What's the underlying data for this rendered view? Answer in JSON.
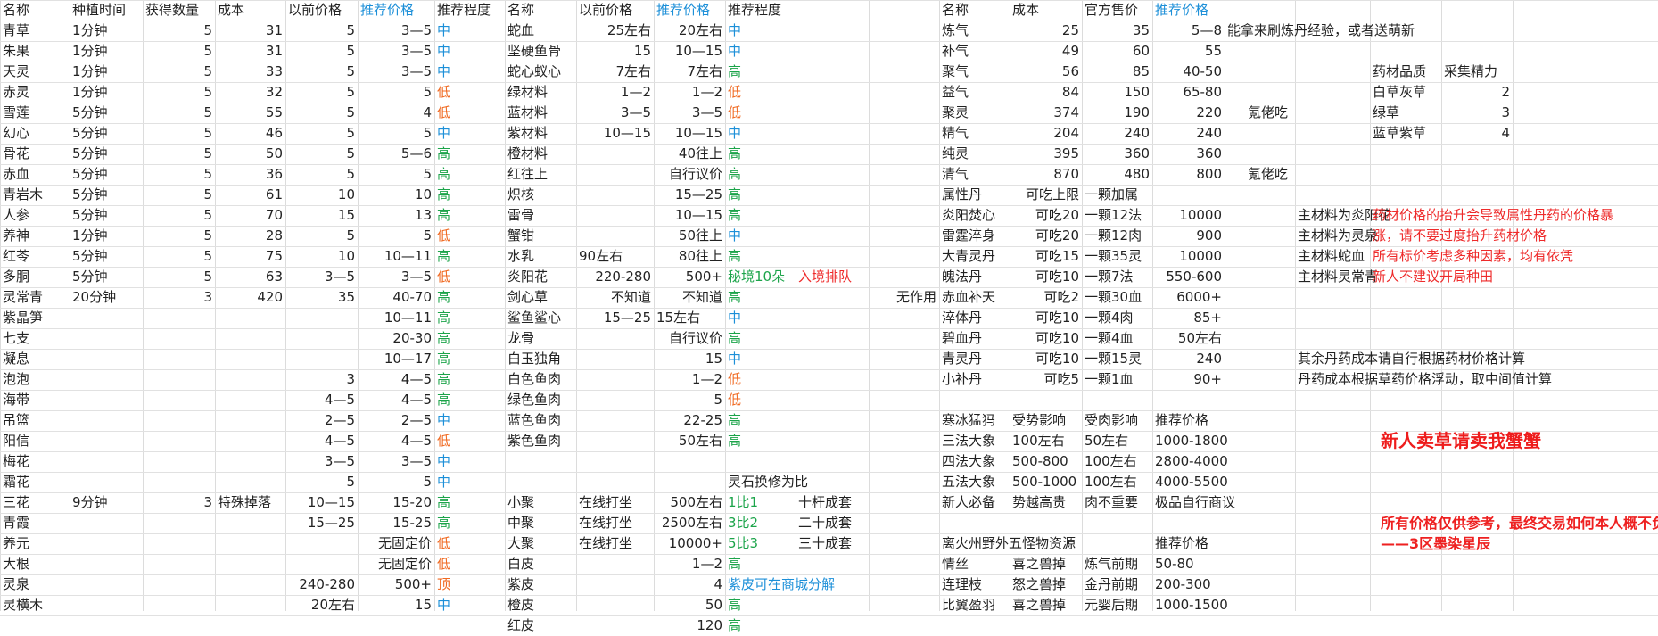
{
  "headers": {
    "a": [
      "名称",
      "种植时间",
      "获得数量",
      "成本",
      "以前价格",
      "推荐价格",
      "推荐程度"
    ],
    "b": [
      "名称",
      "以前价格",
      "推荐价格",
      "推荐程度"
    ],
    "c": [
      "名称",
      "成本",
      "官方售价",
      "推荐价格"
    ]
  },
  "herbs": [
    [
      "青草",
      "1分钟",
      "5",
      "31",
      "5",
      "3—5",
      "中"
    ],
    [
      "朱果",
      "1分钟",
      "5",
      "31",
      "5",
      "3—5",
      "中"
    ],
    [
      "天灵",
      "1分钟",
      "5",
      "33",
      "5",
      "3—5",
      "中"
    ],
    [
      "赤灵",
      "1分钟",
      "5",
      "32",
      "5",
      "5",
      "低"
    ],
    [
      "雪莲",
      "5分钟",
      "5",
      "55",
      "5",
      "4",
      "低"
    ],
    [
      "幻心",
      "5分钟",
      "5",
      "46",
      "5",
      "5",
      "中"
    ],
    [
      "骨花",
      "5分钟",
      "5",
      "50",
      "5",
      "5—6",
      "高"
    ],
    [
      "赤血",
      "5分钟",
      "5",
      "36",
      "5",
      "5",
      "高"
    ],
    [
      "青岩木",
      "5分钟",
      "5",
      "61",
      "10",
      "10",
      "高"
    ],
    [
      "人参",
      "5分钟",
      "5",
      "70",
      "15",
      "13",
      "高"
    ],
    [
      "养神",
      "1分钟",
      "5",
      "28",
      "5",
      "5",
      "低"
    ],
    [
      "红苓",
      "5分钟",
      "5",
      "75",
      "10",
      "10—11",
      "高"
    ],
    [
      "多胴",
      "5分钟",
      "5",
      "63",
      "3—5",
      "3—5",
      "低"
    ],
    [
      "灵常青",
      "20分钟",
      "3",
      "420",
      "35",
      "40-70",
      "高"
    ],
    [
      "紫晶笋",
      "",
      "",
      "",
      "",
      "10—11",
      "高"
    ],
    [
      "七支",
      "",
      "",
      "",
      "",
      "20-30",
      "高"
    ],
    [
      "凝息",
      "",
      "",
      "",
      "",
      "10—17",
      "高"
    ],
    [
      "泡泡",
      "",
      "",
      "",
      "3",
      "4—5",
      "高"
    ],
    [
      "海带",
      "",
      "",
      "",
      "4—5",
      "4—5",
      "高"
    ],
    [
      "吊篮",
      "",
      "",
      "",
      "2—5",
      "2—5",
      "中"
    ],
    [
      "阳信",
      "",
      "",
      "",
      "4—5",
      "4—5",
      "低"
    ],
    [
      "梅花",
      "",
      "",
      "",
      "3—5",
      "3—5",
      "中"
    ],
    [
      "霜花",
      "",
      "",
      "",
      "5",
      "5",
      "中"
    ],
    [
      "三花",
      "9分钟",
      "3",
      "特殊掉落",
      "10—15",
      "15-20",
      "高"
    ],
    [
      "青霞",
      "",
      "",
      "",
      "15—25",
      "15-25",
      "高"
    ],
    [
      "养元",
      "",
      "",
      "",
      "",
      "无固定价",
      "低"
    ],
    [
      "大根",
      "",
      "",
      "",
      "",
      "无固定价",
      "低"
    ],
    [
      "灵泉",
      "",
      "",
      "",
      "240-280",
      "500+",
      "顶"
    ],
    [
      "灵横木",
      "",
      "",
      "",
      "20左右",
      "15",
      "中"
    ]
  ],
  "materials": [
    [
      "蛇血",
      "25左右",
      "20左右",
      "中"
    ],
    [
      "坚硬鱼骨",
      "15",
      "10—15",
      "中"
    ],
    [
      "蛇心蚁心",
      "7左右",
      "7左右",
      "高"
    ],
    [
      "绿材料",
      "1—2",
      "1—2",
      "低"
    ],
    [
      "蓝材料",
      "3—5",
      "3—5",
      "低"
    ],
    [
      "紫材料",
      "10—15",
      "10—15",
      "中"
    ],
    [
      "橙材料",
      "",
      "40往上",
      "高"
    ],
    [
      "红往上",
      "",
      "自行议价",
      "高"
    ],
    [
      "炽核",
      "",
      "15—25",
      "高"
    ],
    [
      "雷骨",
      "",
      "10—15",
      "高"
    ],
    [
      "蟹钳",
      "",
      "50往上",
      "中"
    ],
    [
      "水乳",
      "90左右",
      "80往上",
      "高"
    ],
    [
      "炎阳花",
      "220-280",
      "500+",
      "秘境10朵"
    ],
    [
      "剑心草",
      "不知道",
      "不知道",
      "高"
    ],
    [
      "鲨鱼鲨心",
      "15—25",
      "15左右",
      "中"
    ],
    [
      "龙骨",
      "",
      "自行议价",
      "高"
    ],
    [
      "白玉独角",
      "",
      "15",
      "中"
    ],
    [
      "白色鱼肉",
      "",
      "1—2",
      "低"
    ],
    [
      "绿色鱼肉",
      "",
      "5",
      "低"
    ],
    [
      "蓝色鱼肉",
      "",
      "22-25",
      "高"
    ],
    [
      "紫色鱼肉",
      "",
      "50左右",
      "高"
    ]
  ],
  "queue": {
    "label": "入境排队",
    "note": "无作用"
  },
  "exchange": {
    "header": "灵石换修为比",
    "rows": [
      [
        "小聚",
        "在线打坐",
        "500左右",
        "1比1",
        "十杆成套"
      ],
      [
        "中聚",
        "在线打坐",
        "2500左右",
        "3比2",
        "二十成套"
      ],
      [
        "大聚",
        "在线打坐",
        "10000+",
        "5比3",
        "三十成套"
      ]
    ]
  },
  "skins": [
    [
      "白皮",
      "1—2",
      "高"
    ],
    [
      "紫皮",
      "4",
      ""
    ],
    [
      "橙皮",
      "50",
      "高"
    ],
    [
      "红皮",
      "120",
      "高"
    ]
  ],
  "skin_note": "紫皮可在商城分解",
  "pills": [
    [
      "炼气",
      "25",
      "35",
      "5—8"
    ],
    [
      "补气",
      "49",
      "60",
      "55"
    ],
    [
      "聚气",
      "56",
      "85",
      "40-50"
    ],
    [
      "益气",
      "84",
      "150",
      "65-80"
    ],
    [
      "聚灵",
      "374",
      "190",
      "220"
    ],
    [
      "精气",
      "204",
      "240",
      "240"
    ],
    [
      "纯灵",
      "395",
      "360",
      "360"
    ],
    [
      "清气",
      "870",
      "480",
      "800"
    ],
    [
      "属性丹",
      "可吃上限",
      "一颗加属",
      ""
    ],
    [
      "炎阳焚心",
      "可吃20",
      "一颗12法",
      "10000"
    ],
    [
      "雷霆淬身",
      "可吃20",
      "一颗12肉",
      "900"
    ],
    [
      "大青灵丹",
      "可吃15",
      "一颗35灵",
      "10000"
    ],
    [
      "魄法丹",
      "可吃10",
      "一颗7法",
      "550-600"
    ],
    [
      "赤血补天",
      "可吃2",
      "一颗30血",
      "6000+"
    ],
    [
      "淬体丹",
      "可吃10",
      "一颗4肉",
      "85+"
    ],
    [
      "碧血丹",
      "可吃10",
      "一颗4血",
      "50左右"
    ],
    [
      "青灵丹",
      "可吃10",
      "一颗15灵",
      "240"
    ],
    [
      "小补丹",
      "可吃5",
      "一颗1血",
      "90+"
    ]
  ],
  "pill_notes": {
    "lianqi": "能拿来刷炼丹经验，或者送萌新",
    "juling": "氪佬吃",
    "qingqi": "氪佬吃"
  },
  "monster": {
    "header": [
      "寒冰猛犸",
      "受势影响",
      "受肉影响",
      "推荐价格"
    ],
    "rows": [
      [
        "三法大象",
        "100左右",
        "50左右",
        "1000-1800"
      ],
      [
        "四法大象",
        "500-800",
        "100左右",
        "2800-4000"
      ],
      [
        "五法大象",
        "500-1000",
        "100左右",
        "4000-5500"
      ],
      [
        "新人必备",
        "势越高贵",
        "肉不重要",
        "极品自行商议"
      ]
    ]
  },
  "wild": {
    "header": [
      "离火州野外五怪物资源",
      "推荐价格"
    ],
    "rows": [
      [
        "情丝",
        "喜之兽掉",
        "炼气前期",
        "50-80"
      ],
      [
        "连理枝",
        "怒之兽掉",
        "金丹前期",
        "200-300"
      ],
      [
        "比翼盈羽",
        "喜之兽掉",
        "元婴后期",
        "1000-1500"
      ]
    ]
  },
  "gather": {
    "header": [
      "药材品质",
      "采集精力"
    ],
    "rows": [
      [
        "白草灰草",
        "2"
      ],
      [
        "绿草",
        "3"
      ],
      [
        "蓝草紫草",
        "4"
      ]
    ]
  },
  "main_notes": [
    "主材料为炎阳花",
    "主材料为灵泉",
    "主材料蛇血",
    "主材料灵常青"
  ],
  "red_notes": [
    "药材价格的抬升会导致属性丹药的价格暴",
    "涨，请不要过度抬升药材价格",
    "所有标价考虑多种因素，均有依凭",
    "新人不建议开局种田"
  ],
  "calc_notes": [
    "其余丹药成本请自行根据药材价格计算",
    "丹药成本根据草药价格浮动，取中间值计算"
  ],
  "sell_note": "新人卖草请卖我蟹蟹",
  "disclaimer": [
    "所有价格仅供参考，最终交易如何本人概不负责",
    "——3区墨染星辰"
  ],
  "colors": {
    "header_blue": "#1c8fd8",
    "high": "#1ca44a",
    "low": "#f06a22",
    "red": "#ee2a2a",
    "mid": "#1c8fd8"
  }
}
